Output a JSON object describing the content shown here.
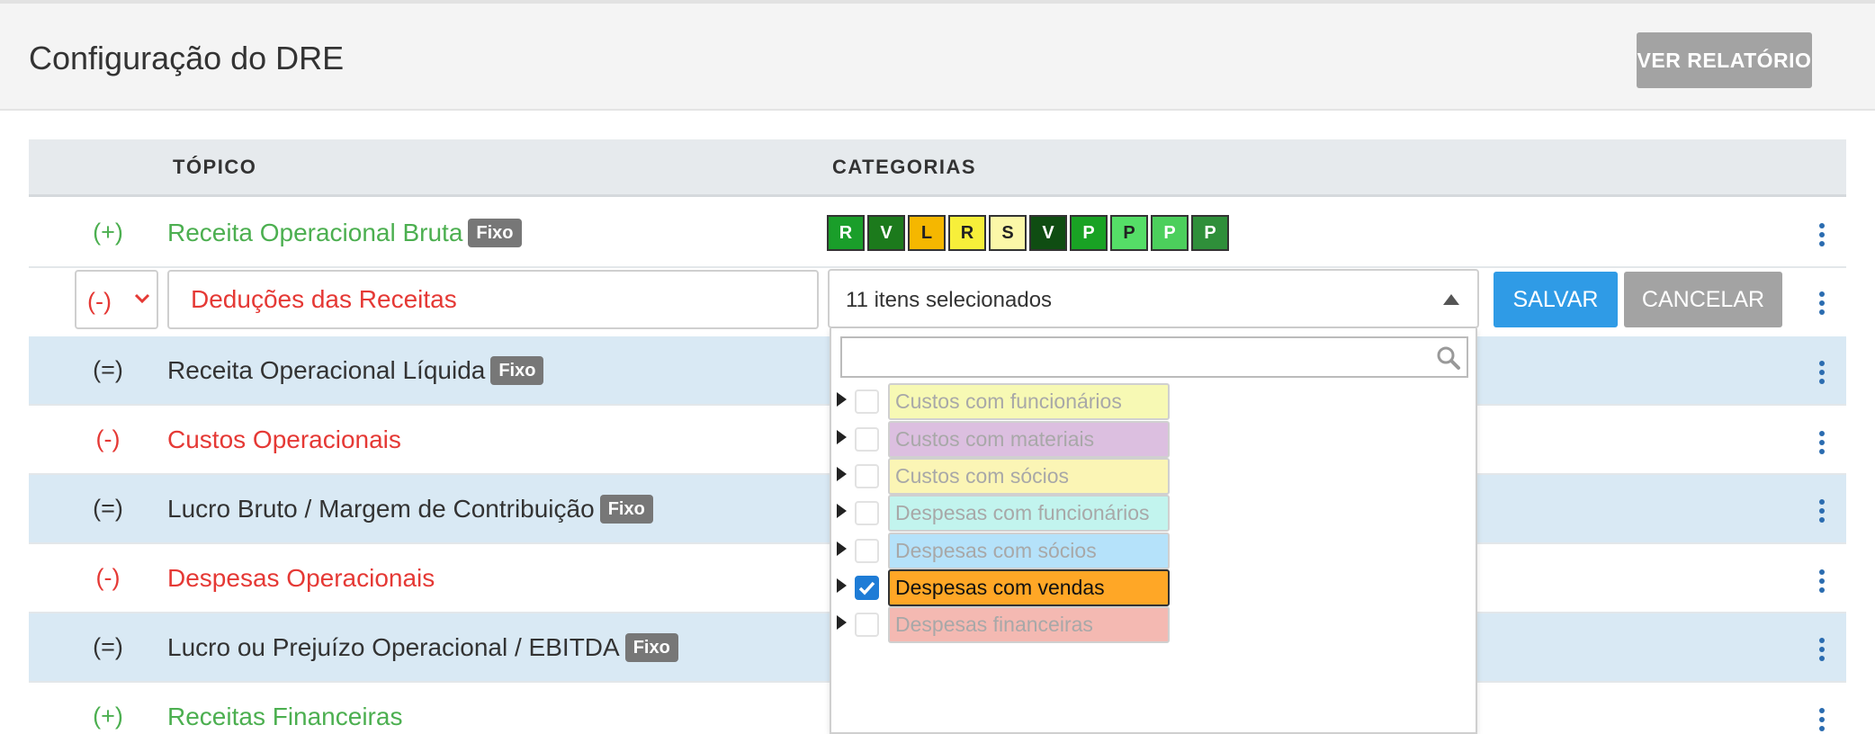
{
  "header": {
    "title": "Configuração do DRE",
    "report_button": "VER RELATÓRIO"
  },
  "table": {
    "col_topic": "TÓPICO",
    "col_categories": "CATEGORIAS",
    "rows": [
      {
        "sign": "(+)",
        "label": "Receita Operacional Bruta",
        "badge": "Fixo",
        "sign_color": "#4caf50",
        "label_color": "#4caf50",
        "alt": false
      },
      {
        "sign": "(-)",
        "label": "Deduções das Receitas",
        "editing": true
      },
      {
        "sign": "(=)",
        "label": "Receita Operacional Líquida",
        "badge": "Fixo",
        "alt": true
      },
      {
        "sign": "(-)",
        "label": "Custos Operacionais",
        "sign_color": "#e53935",
        "label_color": "#e53935",
        "alt": false
      },
      {
        "sign": "(=)",
        "label": "Lucro Bruto / Margem de Contribuição",
        "badge": "Fixo",
        "alt": true
      },
      {
        "sign": "(-)",
        "label": "Despesas Operacionais",
        "sign_color": "#e53935",
        "label_color": "#e53935",
        "alt": false
      },
      {
        "sign": "(=)",
        "label": "Lucro ou Prejuízo Operacional / EBITDA",
        "badge": "Fixo",
        "alt": true
      },
      {
        "sign": "(+)",
        "label": "Receitas Financeiras",
        "sign_color": "#4caf50",
        "label_color": "#4caf50",
        "alt": false
      }
    ]
  },
  "category_chips": [
    {
      "letter": "R",
      "bg": "#1a9e2a",
      "fg": "#ffffff"
    },
    {
      "letter": "V",
      "bg": "#1c7a1c",
      "fg": "#ffffff"
    },
    {
      "letter": "L",
      "bg": "#f5b700",
      "fg": "#222222"
    },
    {
      "letter": "R",
      "bg": "#f7ef3a",
      "fg": "#222222"
    },
    {
      "letter": "S",
      "bg": "#fbf7a8",
      "fg": "#222222"
    },
    {
      "letter": "V",
      "bg": "#0f4d12",
      "fg": "#ffffff"
    },
    {
      "letter": "P",
      "bg": "#19a224",
      "fg": "#ffffff"
    },
    {
      "letter": "P",
      "bg": "#55de67",
      "fg": "#222222"
    },
    {
      "letter": "P",
      "bg": "#4ccf5c",
      "fg": "#ffffff"
    },
    {
      "letter": "P",
      "bg": "#2f8f3a",
      "fg": "#ffffff"
    }
  ],
  "edit_row": {
    "sign_value": "(-)",
    "name_value": "Deduções das Receitas",
    "categories_summary": "11 itens selecionados",
    "save_label": "SALVAR",
    "cancel_label": "CANCELAR"
  },
  "dropdown": {
    "search_placeholder": "",
    "items": [
      {
        "label": "Custos com funcionários",
        "bg": "#f7f9b4",
        "checked": false
      },
      {
        "label": "Custos com materiais",
        "bg": "#dcbfe0",
        "checked": false
      },
      {
        "label": "Custos com sócios",
        "bg": "#fbf5b5",
        "checked": false
      },
      {
        "label": "Despesas com funcionários",
        "bg": "#c2f4ee",
        "checked": false
      },
      {
        "label": "Despesas com sócios",
        "bg": "#b5e2fa",
        "checked": false
      },
      {
        "label": "Despesas com vendas",
        "bg": "#ffa726",
        "checked": true
      },
      {
        "label": "Despesas financeiras",
        "bg": "#f4b9b2",
        "checked": false
      }
    ]
  }
}
